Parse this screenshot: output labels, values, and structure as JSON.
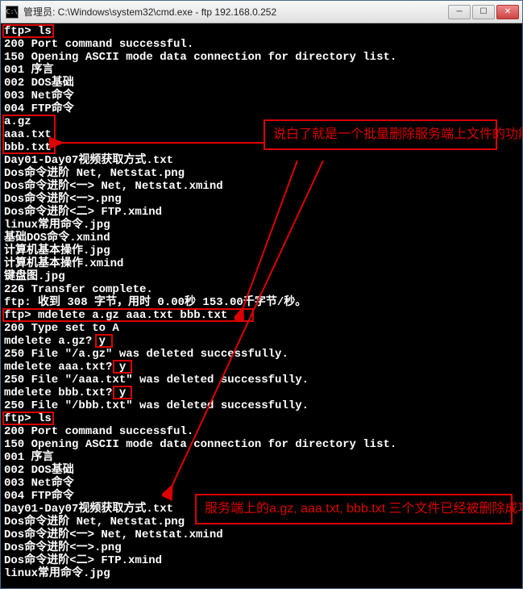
{
  "titlebar": {
    "icon_label": "C:\\",
    "text": "管理员: C:\\Windows\\system32\\cmd.exe - ftp  192.168.0.252"
  },
  "terminal": {
    "lines": [
      "ftp> ls",
      "200 Port command successful.",
      "150 Opening ASCII mode data connection for directory list.",
      "001 序言",
      "002 DOS基础",
      "003 Net命令",
      "004 FTP命令",
      "a.gz",
      "aaa.txt",
      "bbb.txt",
      "Day01-Day07视频获取方式.txt",
      "Dos命令进阶 Net, Netstat.png",
      "Dos命令进阶<一> Net, Netstat.xmind",
      "Dos命令进阶<一>.png",
      "Dos命令进阶<二> FTP.xmind",
      "linux常用命令.jpg",
      "基础DOS命令.xmind",
      "计算机基本操作.jpg",
      "计算机基本操作.xmind",
      "键盘图.jpg",
      "226 Transfer complete.",
      "ftp: 收到 308 字节，用时 0.00秒 153.00千字节/秒。",
      "ftp> mdelete a.gz aaa.txt bbb.txt",
      "200 Type set to A",
      "mdelete a.gz? y",
      "250 File \"/a.gz\" was deleted successfully.",
      "mdelete aaa.txt? y",
      "250 File \"/aaa.txt\" was deleted successfully.",
      "mdelete bbb.txt? y",
      "250 File \"/bbb.txt\" was deleted successfully.",
      "ftp> ls",
      "200 Port command successful.",
      "150 Opening ASCII mode data connection for directory list.",
      "001 序言",
      "002 DOS基础",
      "003 Net命令",
      "004 FTP命令",
      "Day01-Day07视频获取方式.txt",
      "Dos命令进阶 Net, Netstat.png",
      "Dos命令进阶<一> Net, Netstat.xmind",
      "Dos命令进阶<一>.png",
      "Dos命令进阶<二> FTP.xmind",
      "linux常用命令.jpg"
    ]
  },
  "annotations": {
    "top": "说白了就是一个批量删除服务端上文件的功能命令.",
    "bottom": "服务端上的a.gz, aaa.txt, bbb.txt 三个文件已经被删除成功了"
  }
}
